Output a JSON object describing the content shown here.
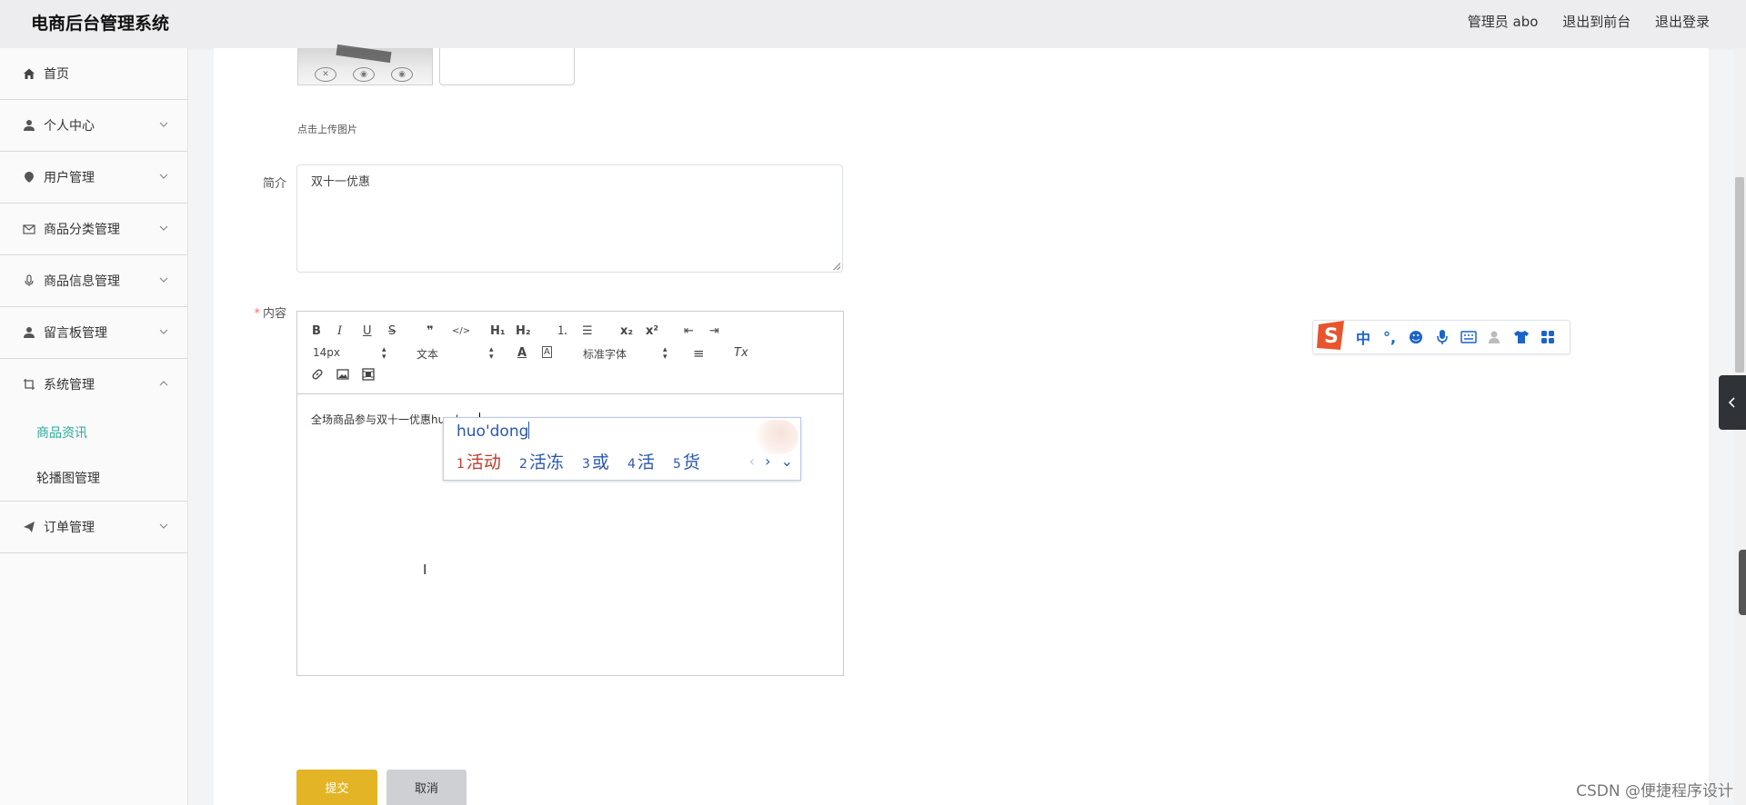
{
  "header": {
    "app_title": "电商后台管理系统",
    "admin_label": "管理员 abo",
    "to_frontend": "退出到前台",
    "logout": "退出登录"
  },
  "sidebar": {
    "items": [
      {
        "label": "首页",
        "icon": "home-icon"
      },
      {
        "label": "个人中心",
        "icon": "user-icon"
      },
      {
        "label": "用户管理",
        "icon": "location-icon"
      },
      {
        "label": "商品分类管理",
        "icon": "mail-icon"
      },
      {
        "label": "商品信息管理",
        "icon": "microphone-icon"
      },
      {
        "label": "留言板管理",
        "icon": "user-icon"
      },
      {
        "label": "系统管理",
        "icon": "crop-icon"
      },
      {
        "label": "订单管理",
        "icon": "send-icon"
      }
    ],
    "sub_items": [
      {
        "label": "商品资讯",
        "active": true
      },
      {
        "label": "轮播图管理",
        "active": false
      }
    ]
  },
  "form": {
    "upload_hint": "点击上传图片",
    "summary_label": "简介",
    "summary_value": "双十一优惠",
    "content_label": "内容",
    "content_text": "全场商品参与双十一优惠huodong",
    "font_size": "14px",
    "block_format": "文本",
    "font_family": "标准字体"
  },
  "toolbar": {
    "bold": "B",
    "italic": "I",
    "underline": "U",
    "strike": "S",
    "quote": "❞",
    "code": "</>",
    "h1": "H₁",
    "h2": "H₂",
    "ordered_list": "⒈",
    "bullet_list": "☰",
    "subscript": "x₂",
    "superscript": "x²",
    "outdent": "⇤",
    "indent": "⇥",
    "font_color": "A",
    "bg_color": "A",
    "align": "≡",
    "clean": "Tx",
    "link": "🔗",
    "image": "▣",
    "video": "▤"
  },
  "ime": {
    "pinyin": "huo'dong",
    "candidates": [
      {
        "num": "1",
        "text": "活动"
      },
      {
        "num": "2",
        "text": "活冻"
      },
      {
        "num": "3",
        "text": "或"
      },
      {
        "num": "4",
        "text": "活"
      },
      {
        "num": "5",
        "text": "货"
      }
    ],
    "prev": "‹",
    "next": "›",
    "expand": "⌄"
  },
  "ime_bar": {
    "mode": "中",
    "punct": "°,",
    "emoji": "☻",
    "mic": "🎤",
    "keyboard": "⌨",
    "user": "👤",
    "skin": "👕",
    "apps": "▦"
  },
  "buttons": {
    "submit": "提交",
    "cancel": "取消"
  },
  "watermark": "CSDN @便捷程序设计",
  "colors": {
    "accent": "#2aa99a",
    "submit": "#e3b425",
    "ime_blue": "#2a56b0",
    "ime_red": "#c0392b"
  }
}
